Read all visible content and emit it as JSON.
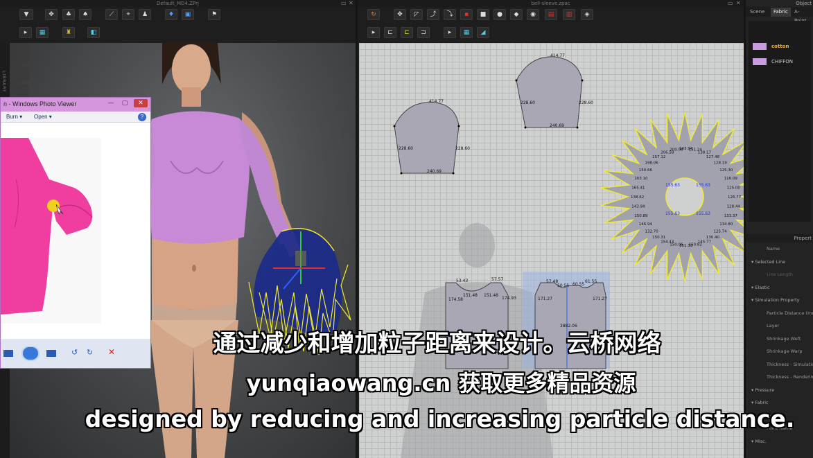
{
  "window_3d": {
    "title": "Default_MD4.ZPrj",
    "library_label": "LIBRARY"
  },
  "window_2d": {
    "title": "bell-sleeve.zpac"
  },
  "photo_viewer": {
    "title": "n - Windows Photo Viewer",
    "menu": {
      "burn": "Burn",
      "open": "Open",
      "help": "?"
    }
  },
  "patterns": {
    "sleeve_left": {
      "top": "414.77",
      "left": "228.60",
      "right": "228.60",
      "bottom": "240.69"
    },
    "sleeve_right": {
      "top": "414.77",
      "left": "228.60",
      "right": "228.60",
      "bottom": "240.69"
    },
    "ruffle_labels": [
      "143.94",
      "151.24",
      "138.17",
      "127.48",
      "128.19",
      "125.30",
      "116.09",
      "125.00",
      "126.77",
      "128.44",
      "133.37",
      "134.80",
      "125.74",
      "130.40",
      "145.77",
      "150.82",
      "151.33",
      "150.06",
      "154.43",
      "150.31",
      "132.70",
      "146.94",
      "150.89",
      "143.94",
      "138.62",
      "165.41",
      "163.10",
      "150.66",
      "198.06",
      "157.12",
      "206.58",
      "200.06"
    ],
    "ruffle_inner": [
      "155.63",
      "155.63",
      "155.63",
      "155.63"
    ],
    "bodice_front": [
      "53.43",
      "57.57",
      "174.58",
      "151.48",
      "151.48",
      "174.93"
    ],
    "bodice_back": [
      "57.48",
      "50.55",
      "60.55",
      "61.55",
      "171.27",
      "171.27",
      "3882.06"
    ]
  },
  "right_panel": {
    "header": "Object",
    "tabs": [
      "Scene",
      "Fabric",
      "A-Point"
    ],
    "fabrics": [
      {
        "name": "cotton",
        "color": "#f0b040"
      },
      {
        "name": "CHIFFON",
        "color": "#cccccc"
      }
    ],
    "property_header": "Propert",
    "properties": [
      {
        "label": "Name",
        "type": "row"
      },
      {
        "label": "Selected Line",
        "type": "section"
      },
      {
        "label": "Line Length",
        "type": "dim"
      },
      {
        "label": "Elastic",
        "type": "section"
      },
      {
        "label": "Simulation Property",
        "type": "section"
      },
      {
        "label": "Particle Distance (mm)",
        "type": "row"
      },
      {
        "label": "Layer",
        "type": "row"
      },
      {
        "label": "Shrinkage Weft",
        "type": "row"
      },
      {
        "label": "Shrinkage Warp",
        "type": "row"
      },
      {
        "label": "Thickness - Simulation",
        "type": "row"
      },
      {
        "label": "Thickness - Rendering",
        "type": "row"
      },
      {
        "label": "Pressure",
        "type": "section"
      },
      {
        "label": "Fabric",
        "type": "section"
      },
      {
        "label": "Fabric",
        "type": "row"
      },
      {
        "label": "Point Name",
        "type": "row"
      },
      {
        "label": "Misc.",
        "type": "section"
      }
    ]
  },
  "subtitles": {
    "line1": "通过减少和增加粒子距离来设计。云桥网络",
    "line2": "yunqiaowang.cn 获取更多精品资源",
    "line3": "designed by reducing and increasing particle distance."
  },
  "colors": {
    "garment": "#c98ad8",
    "photo_dress": "#ef3ea0",
    "ruffle_outline": "#f2ea30"
  }
}
